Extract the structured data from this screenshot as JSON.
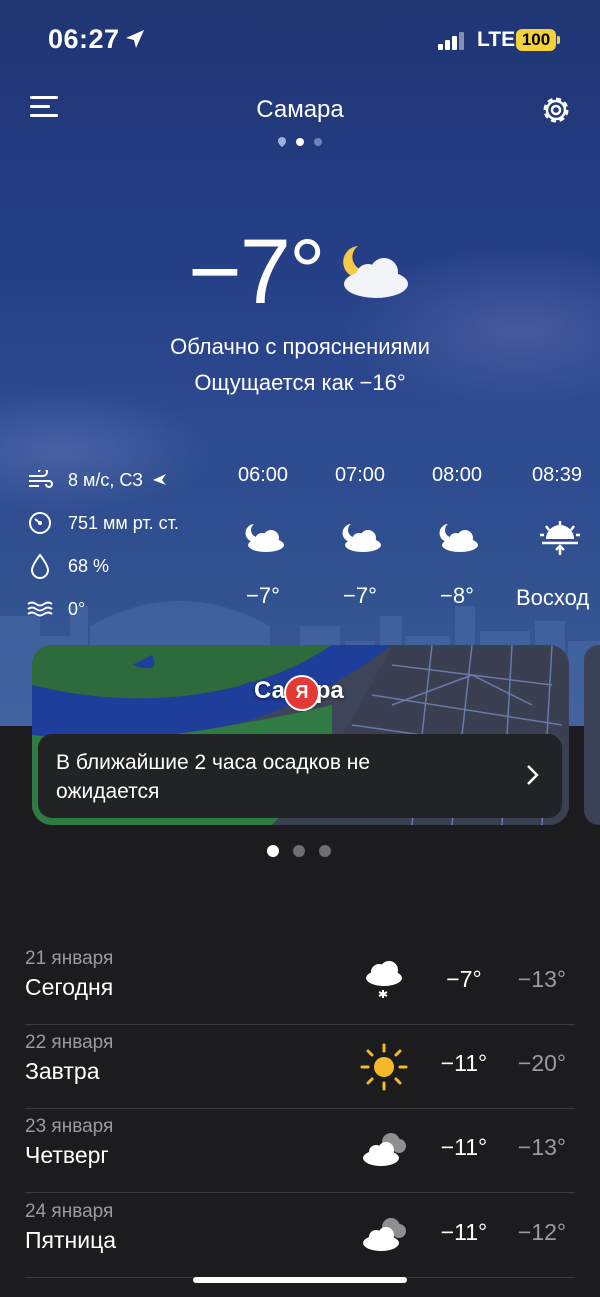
{
  "status_bar": {
    "time": "06:27",
    "network": "LTE",
    "battery": "100"
  },
  "header": {
    "city": "Самара"
  },
  "current": {
    "temperature": "−7°",
    "condition": "Облачно с прояснениями",
    "feels_like": "Ощущается как −16°",
    "icon": "moon-cloud-icon"
  },
  "details": {
    "wind": "8 м/с, СЗ",
    "pressure": "751 мм рт. ст.",
    "humidity": "68 %",
    "water_temp": "0°"
  },
  "hourly": [
    {
      "time": "06:00",
      "temp": "−7°",
      "icon": "moon-cloud-icon"
    },
    {
      "time": "07:00",
      "temp": "−7°",
      "icon": "moon-cloud-icon"
    },
    {
      "time": "08:00",
      "temp": "−8°",
      "icon": "moon-cloud-icon"
    },
    {
      "time": "08:39",
      "temp": "Восход",
      "icon": "sunrise-icon"
    }
  ],
  "map": {
    "city_label": "Самара",
    "pin_letter": "Я",
    "precip_text": "В ближайшие 2 часа осадков не ожидается"
  },
  "daily": [
    {
      "date": "21 января",
      "name": "Сегодня",
      "hi": "−7°",
      "lo": "−13°",
      "icon": "snow-cloud-icon"
    },
    {
      "date": "22 января",
      "name": "Завтра",
      "hi": "−11°",
      "lo": "−20°",
      "icon": "sun-icon"
    },
    {
      "date": "23 января",
      "name": "Четверг",
      "hi": "−11°",
      "lo": "−13°",
      "icon": "clouds-icon"
    },
    {
      "date": "24 января",
      "name": "Пятница",
      "hi": "−11°",
      "lo": "−12°",
      "icon": "clouds-icon"
    }
  ],
  "colors": {
    "sky_top": "#1f3573",
    "sky_bottom": "#3a5b99",
    "background": "#1c1c1e",
    "battery": "#f6d23a",
    "sun": "#f6b92b"
  }
}
